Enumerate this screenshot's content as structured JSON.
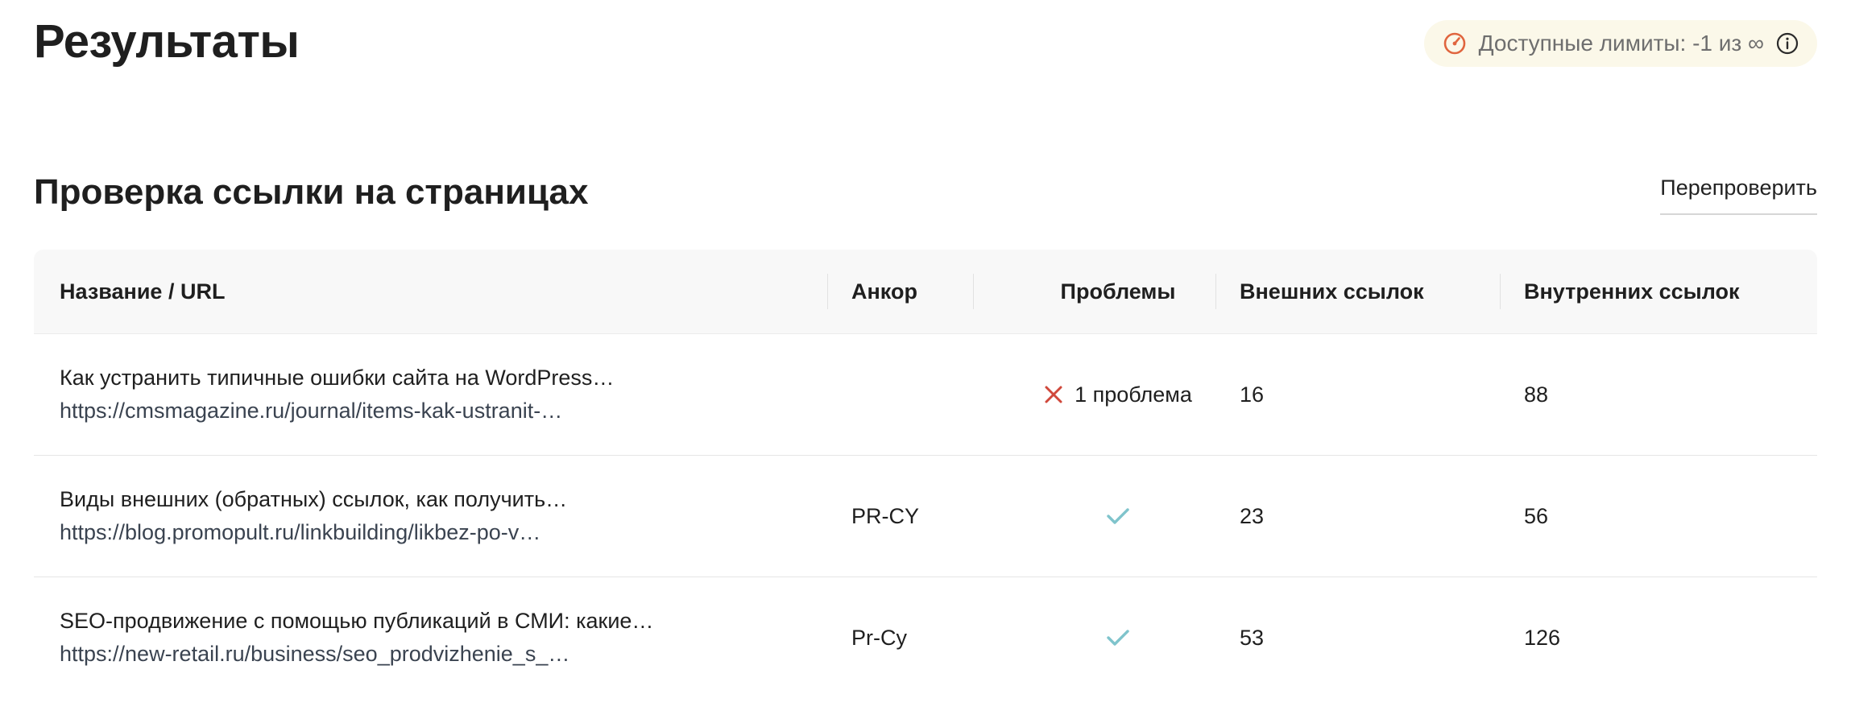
{
  "header": {
    "title": "Результаты",
    "limits_label": "Доступные лимиты: -1 из ∞"
  },
  "section": {
    "title": "Проверка ссылки на страницах",
    "recheck_label": "Перепроверить"
  },
  "table": {
    "columns": {
      "name": "Название / URL",
      "anchor": "Анкор",
      "problems": "Проблемы",
      "external": "Внешних ссылок",
      "internal": "Внутренних ссылок"
    },
    "rows": [
      {
        "title": "Как устранить типичные ошибки сайта на WordPress…",
        "url": "https://cmsmagazine.ru/journal/items-kak-ustranit-…",
        "anchor": "",
        "problems": "1 проблема",
        "problem_status": "error",
        "external": "16",
        "internal": "88"
      },
      {
        "title": "Виды внешних (обратных) ссылок, как получить…",
        "url": "https://blog.promopult.ru/linkbuilding/likbez-po-v…",
        "anchor": "PR-CY",
        "problems": "",
        "problem_status": "ok",
        "external": "23",
        "internal": "56"
      },
      {
        "title": "SEO-продвижение с помощью публикаций в СМИ: какие…",
        "url": "https://new-retail.ru/business/seo_prodvizhenie_s_…",
        "anchor": "Pr-Cy",
        "problems": "",
        "problem_status": "ok",
        "external": "53",
        "internal": "126"
      }
    ]
  },
  "icons": {
    "limits": "gauge-icon",
    "info": "info-icon",
    "error": "close-icon",
    "ok": "check-icon"
  },
  "colors": {
    "limits_bg": "#fbf8e9",
    "gauge": "#e0653e",
    "error": "#d0483b",
    "ok": "#7fc4cc"
  }
}
